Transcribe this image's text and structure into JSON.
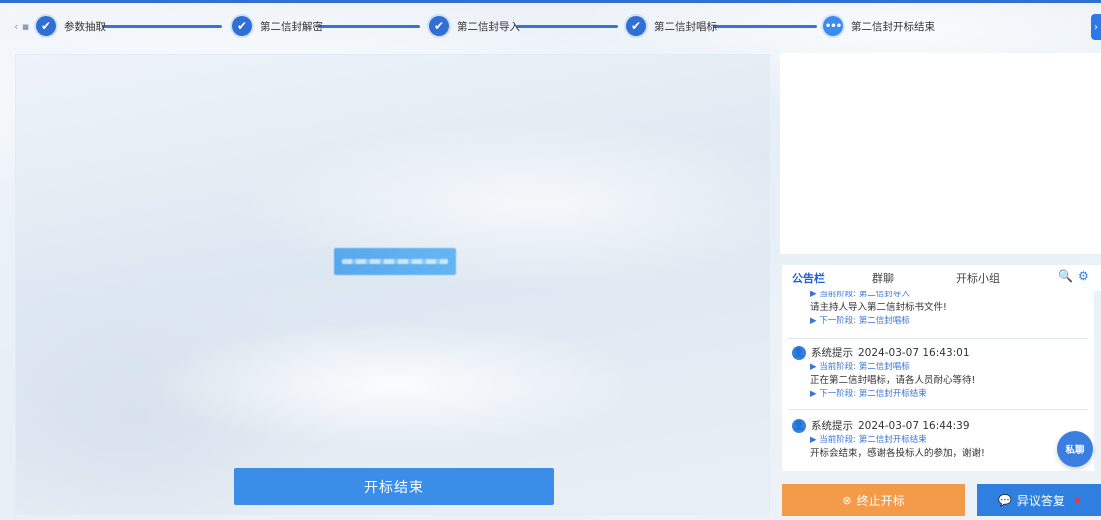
{
  "steps": [
    {
      "label": "参数抽取",
      "state": "done"
    },
    {
      "label": "第二信封解密",
      "state": "done"
    },
    {
      "label": "第二信封导入",
      "state": "done"
    },
    {
      "label": "第二信封唱标",
      "state": "done"
    },
    {
      "label": "第二信封开标结束",
      "state": "current"
    }
  ],
  "icons": {
    "check": "✔",
    "current": "•••",
    "prev": "‹ ▪",
    "next": "›",
    "search": "🔍",
    "settings": "⚙",
    "user": "👤",
    "stop": "⊗",
    "message": "💬"
  },
  "main": {
    "end_button_label": "开标结束"
  },
  "tabs": {
    "announcement": "公告栏",
    "group_chat": "群聊",
    "bid_team": "开标小组"
  },
  "feed": {
    "top_partial": {
      "current_stage": "▶ 当前阶段: 第二信封导入",
      "message": "请主持人导入第二信封标书文件!",
      "next_stage": "▶ 下一阶段: 第二信封唱标"
    },
    "entries": [
      {
        "title": "系统提示",
        "time": "2024-03-07 16:43:01",
        "current_stage": "▶ 当前阶段: 第二信封唱标",
        "message": "正在第二信封唱标，请各人员耐心等待!",
        "next_stage": "▶ 下一阶段: 第二信封开标结束"
      },
      {
        "title": "系统提示",
        "time": "2024-03-07 16:44:39",
        "current_stage": "▶ 当前阶段: 第二信封开标结束",
        "message": "开标会结束，感谢各投标人的参加，谢谢!"
      }
    ]
  },
  "chat_fab_label": "私聊",
  "buttons": {
    "stop_label": "终止开标",
    "objection_label": "异议答复"
  },
  "colors": {
    "primary": "#2f6fd6",
    "stop": "#f39b49",
    "objection": "#2f7fe0",
    "alert_dot": "#ff2f2f"
  }
}
